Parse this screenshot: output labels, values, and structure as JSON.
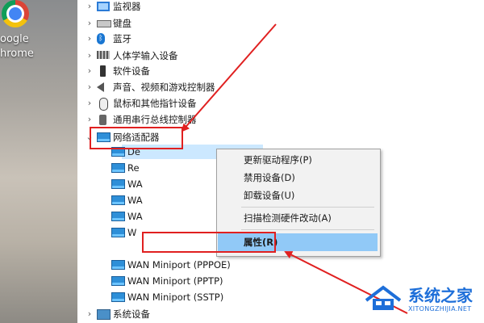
{
  "desktop": {
    "shortcut_label_line1": "oogle",
    "shortcut_label_line2": "hrome",
    "shortcut_icon": "chrome-icon"
  },
  "tree": {
    "categories_top": [
      {
        "label": "监视器",
        "icon": "monitor-icon",
        "expanded": false
      },
      {
        "label": "键盘",
        "icon": "keyboard-icon",
        "expanded": false
      },
      {
        "label": "蓝牙",
        "icon": "bluetooth-icon",
        "expanded": false
      },
      {
        "label": "人体学输入设备",
        "icon": "hid-icon",
        "expanded": false
      },
      {
        "label": "软件设备",
        "icon": "software-device-icon",
        "expanded": false
      },
      {
        "label": "声音、视频和游戏控制器",
        "icon": "speaker-icon",
        "expanded": false
      },
      {
        "label": "鼠标和其他指针设备",
        "icon": "mouse-icon",
        "expanded": false
      },
      {
        "label": "通用串行总线控制器",
        "icon": "usb-icon",
        "expanded": false
      }
    ],
    "network_adapters": {
      "label": "网络适配器",
      "icon": "network-adapter-icon",
      "expanded": true,
      "children": [
        "De",
        "Re",
        "WA",
        "WA",
        "WA",
        "W",
        "WAN Miniport (PPPOE)",
        "WAN Miniport (PPTP)",
        "WAN Miniport (SSTP)"
      ]
    },
    "categories_bottom": [
      {
        "label": "系统设备",
        "icon": "system-device-icon",
        "expanded": false
      }
    ]
  },
  "context_menu": {
    "items": [
      {
        "label": "更新驱动程序(P)"
      },
      {
        "label": "禁用设备(D)"
      },
      {
        "label": "卸载设备(U)"
      },
      {
        "label": "扫描检测硬件改动(A)"
      },
      {
        "label": "属性(R)"
      }
    ],
    "highlighted_index": 4
  },
  "watermark": {
    "title": "系统之家",
    "subtitle": "XITONGZHIJIA.NET"
  },
  "colors": {
    "annotation_red": "#e02020",
    "selection_blue": "#cce8ff",
    "menu_highlight": "#91c9f7",
    "watermark_blue": "#1e6fd9"
  }
}
